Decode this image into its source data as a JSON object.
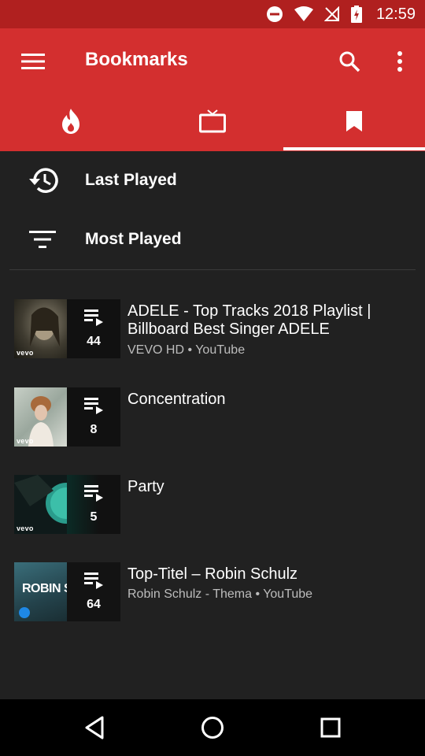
{
  "status_bar": {
    "time": "12:59"
  },
  "toolbar": {
    "title": "Bookmarks"
  },
  "tabs": [
    {
      "name": "trending",
      "icon": "flame-icon",
      "selected": false
    },
    {
      "name": "channels",
      "icon": "tv-icon",
      "selected": false
    },
    {
      "name": "bookmarks",
      "icon": "bookmark-icon",
      "selected": true
    }
  ],
  "shortcuts": [
    {
      "label": "Last Played",
      "icon": "history-icon"
    },
    {
      "label": "Most Played",
      "icon": "sort-icon"
    }
  ],
  "playlists": [
    {
      "title": "ADELE - Top Tracks 2018 Playlist | Billboard Best Singer ADELE",
      "subtitle": "VEVO HD • YouTube",
      "count": "44",
      "thumb_badge": "vevo"
    },
    {
      "title": "Concentration",
      "subtitle": "",
      "count": "8",
      "thumb_badge": "vevo"
    },
    {
      "title": "Party",
      "subtitle": "",
      "count": "5",
      "thumb_badge": "vevo"
    },
    {
      "title": "Top-Titel – Robin Schulz",
      "subtitle": "Robin Schulz - Thema • YouTube",
      "count": "64",
      "thumb_badge": "ROBIN SCHULZ"
    }
  ],
  "colors": {
    "primary": "#d32f2f",
    "status_bar": "#b0201f",
    "background": "#212121"
  }
}
